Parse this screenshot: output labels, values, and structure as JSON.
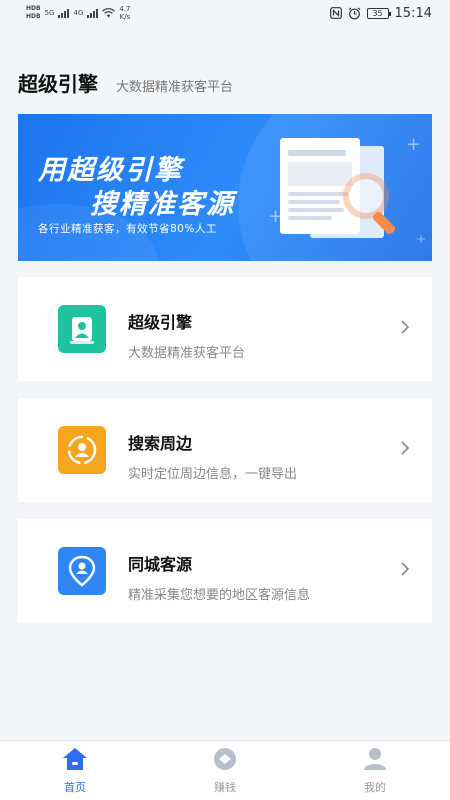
{
  "status_bar": {
    "hd1": "HD",
    "hd1_sub": "B",
    "hd2": "HD",
    "hd2_sub": "B",
    "net1": "5G",
    "net2": "4G",
    "speed_value": "4.7",
    "speed_unit": "K/s",
    "battery": "35",
    "time": "15:14"
  },
  "header": {
    "title": "超级引擎",
    "subtitle": "大数据精准获客平台"
  },
  "banner": {
    "line1": "用超级引擎",
    "line2": "搜精准客源",
    "tagline": "各行业精准获客，有效节省80%人工"
  },
  "cards": [
    {
      "title": "超级引擎",
      "desc": "大数据精准获客平台",
      "icon": "user-bolt-icon",
      "color": "#1fc3a0"
    },
    {
      "title": "搜索周边",
      "desc": "实时定位周边信息，一键导出",
      "icon": "location-user-icon",
      "color": "#f7a51f"
    },
    {
      "title": "同城客源",
      "desc": "精准采集您想要的地区客源信息",
      "icon": "pin-user-icon",
      "color": "#2f86f2"
    }
  ],
  "bottom_nav": [
    {
      "label": "首页",
      "icon": "home-icon",
      "active": true
    },
    {
      "label": "赚钱",
      "icon": "coin-icon",
      "active": false
    },
    {
      "label": "我的",
      "icon": "profile-icon",
      "active": false
    }
  ],
  "colors": {
    "accent": "#2f6cf4",
    "banner": "#1c74ee",
    "background": "#f4f5f8"
  }
}
